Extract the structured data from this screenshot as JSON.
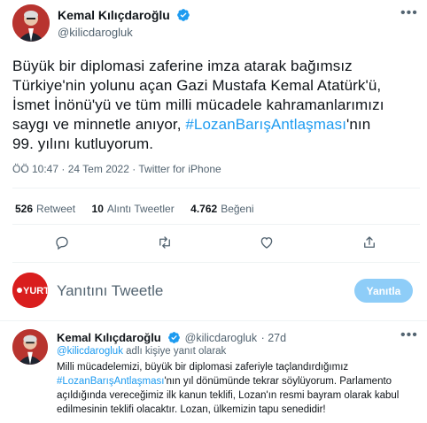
{
  "main_tweet": {
    "author_name": "Kemal Kılıçdaroğlu",
    "author_handle": "@kilicdarogluk",
    "more_icon": "more-icon",
    "text_line1": "Büyük bir diplomasi zaferine imza atarak bağımsız",
    "text_line2": "Türkiye'nin yolunu açan Gazi Mustafa Kemal Atatürk'ü,",
    "text_line3": "İsmet İnönü'yü ve tüm milli mücadele kahramanlarımızı",
    "text_line4_pre": "saygı ve minnetle anıyor, ",
    "text_line4_hashtag": "#LozanBarışAntlaşması",
    "text_line4_post": "'nın",
    "text_line5": "99. yılını kutluyorum.",
    "time": "ÖÖ 10:47",
    "date": "24 Tem 2022",
    "source": "Twitter for iPhone",
    "retweet_count": "526",
    "retweet_label": "Retweet",
    "quote_count": "10",
    "quote_label": "Alıntı Tweetler",
    "like_count": "4.762",
    "like_label": "Beğeni"
  },
  "reply_box": {
    "placeholder": "Yanıtını Tweetle",
    "button_label": "Yanıtla",
    "avatar_label": "YURT"
  },
  "reply_tweet": {
    "author_name": "Kemal Kılıçdaroğlu",
    "author_handle": "@kilicdarogluk",
    "age": "· 27d",
    "replying_handle": "@kilicdarogluk",
    "replying_suffix": "adlı kişiye yanıt olarak",
    "line1": "Milli mücadelemizi, büyük bir diplomasi zaferiyle taçlandırdığımız",
    "line2_hashtag": "#LozanBarışAntlaşması",
    "line2_post": "'nın yıl dönümünde tekrar söylüyorum. Parlamento",
    "line3": "açıldığında vereceğimiz ilk kanun teklifi, Lozan'ın resmi bayram olarak kabul",
    "line4": "edilmesinin teklifi olacaktır. Lozan, ülkemizin tapu senedidir!"
  },
  "colors": {
    "accent": "#1d9bf0",
    "reply_button": "#8ecdf8",
    "secondary_text": "#536471"
  }
}
